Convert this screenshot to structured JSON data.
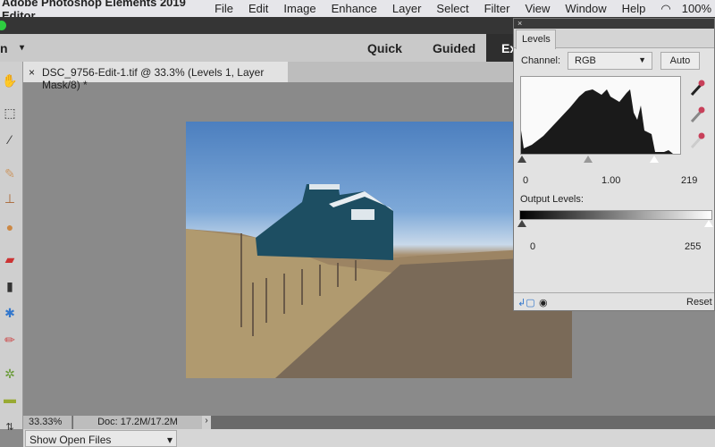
{
  "menubar": {
    "app": "Adobe Photoshop Elements 2019 Editor",
    "items": [
      "File",
      "Edit",
      "Image",
      "Enhance",
      "Layer",
      "Select",
      "Filter",
      "View",
      "Window",
      "Help"
    ],
    "battery": "100%"
  },
  "modebar": {
    "left_label": "n",
    "modes": [
      "Quick",
      "Guided",
      "Ex"
    ],
    "active": "Ex"
  },
  "document_tab": {
    "close": "×",
    "title": "DSC_9756-Edit-1.tif @ 33.3% (Levels 1, Layer Mask/8) *"
  },
  "status": {
    "zoom": "33.33%",
    "doc": "Doc: 17.2M/17.2M",
    "arrow": "›"
  },
  "bottom": {
    "open_files": "Show Open Files"
  },
  "levels": {
    "close": "×",
    "tab": "Levels",
    "channel_label": "Channel:",
    "channel_value": "RGB",
    "auto": "Auto",
    "input_black": "0",
    "input_gamma": "1.00",
    "input_white": "219",
    "output_label": "Output Levels:",
    "output_black": "0",
    "output_white": "255",
    "reset": "Reset"
  },
  "colors": {
    "accent_dark": "#2e2e2e",
    "eyedropper": "#c8405a"
  }
}
